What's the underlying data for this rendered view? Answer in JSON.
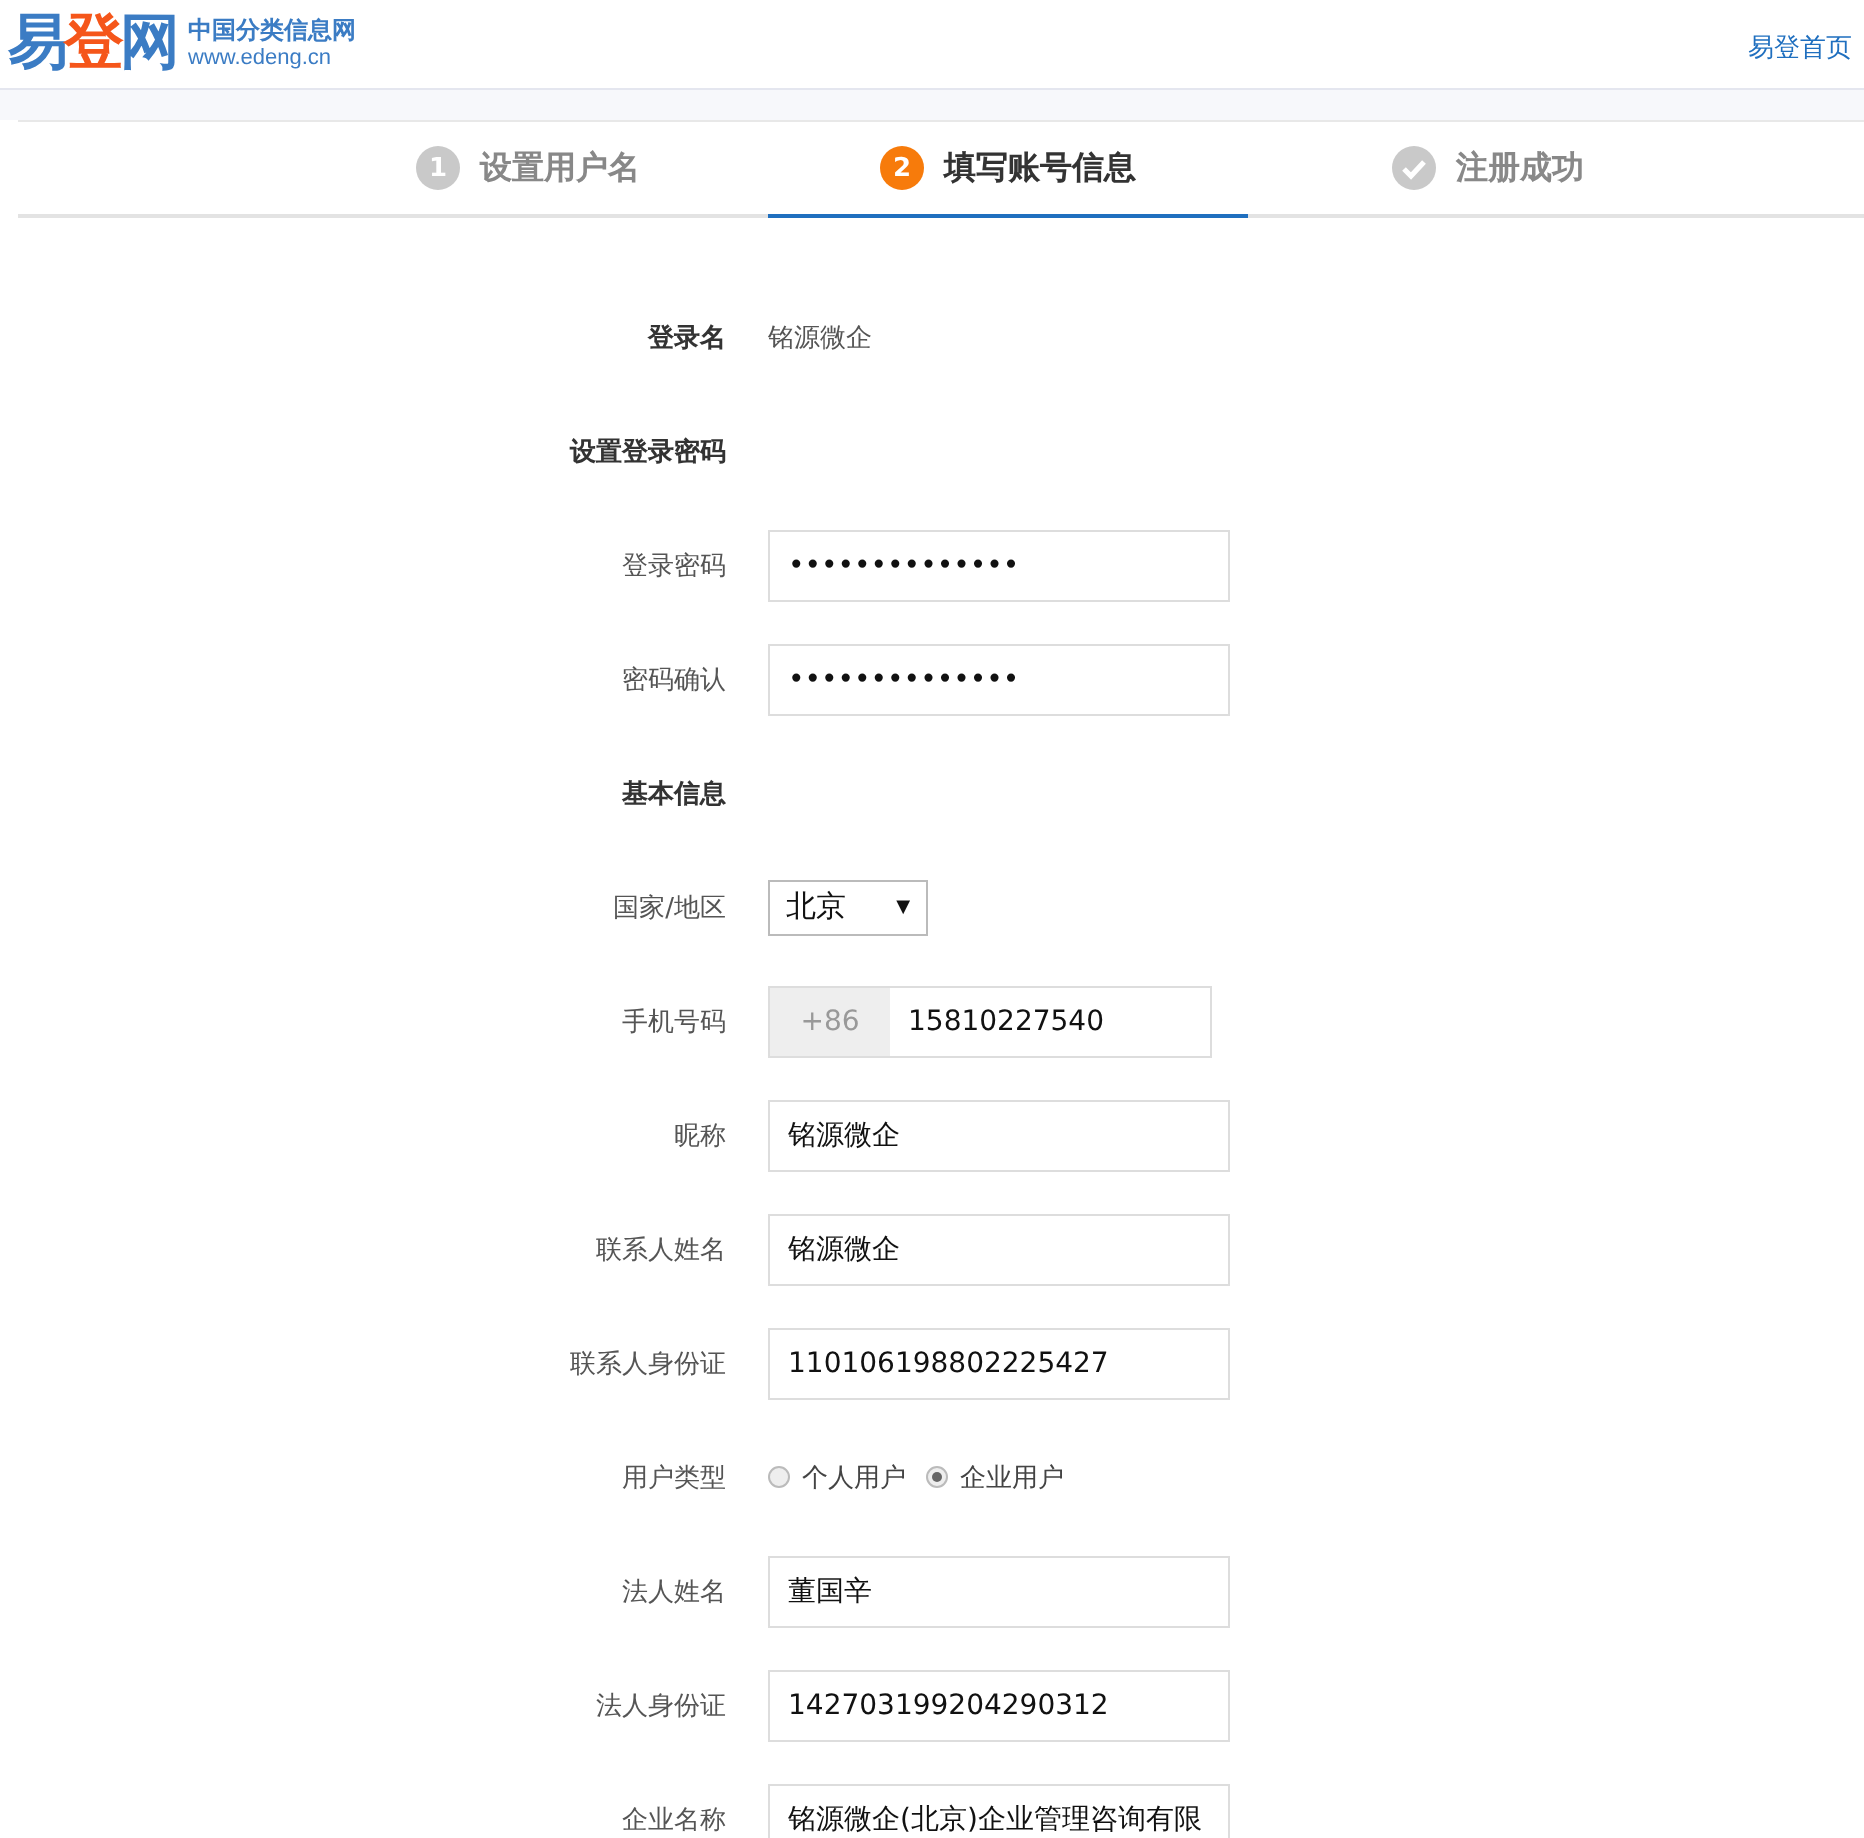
{
  "logo": {
    "parts": [
      {
        "text": "易",
        "color": "#3b7cc4"
      },
      {
        "text": "登",
        "color": "#f5561a"
      },
      {
        "text": "网",
        "color": "#3b7cc4"
      }
    ],
    "tagline": "中国分类信息网",
    "url": "www.edeng.cn"
  },
  "home_link": "易登首页",
  "steps": [
    {
      "kind": "number",
      "number": "1",
      "label": "设置用户名",
      "selected": false
    },
    {
      "kind": "number",
      "number": "2",
      "label": "填写账号信息",
      "selected": true
    },
    {
      "kind": "check",
      "label": "注册成功",
      "selected": false
    }
  ],
  "form": [
    {
      "kind": "static",
      "label": "登录名",
      "value": "铭源微企"
    },
    {
      "kind": "section",
      "label": "设置登录密码"
    },
    {
      "kind": "input",
      "label": "登录密码",
      "value": "••••••••••••••"
    },
    {
      "kind": "input",
      "label": "密码确认",
      "value": "••••••••••••••"
    },
    {
      "kind": "section",
      "label": "基本信息"
    },
    {
      "kind": "select",
      "label": "国家/地区",
      "value": "北京",
      "caret": "▼"
    },
    {
      "kind": "phone",
      "label": "手机号码",
      "prefix": "+86",
      "value": "15810227540"
    },
    {
      "kind": "input",
      "label": "昵称",
      "value": "铭源微企"
    },
    {
      "kind": "input",
      "label": "联系人姓名",
      "value": "铭源微企"
    },
    {
      "kind": "input",
      "label": "联系人身份证",
      "value": "110106198802225427"
    },
    {
      "kind": "radio",
      "label": "用户类型",
      "options": [
        {
          "label": "个人用户",
          "selected": false
        },
        {
          "label": "企业用户",
          "selected": true
        }
      ]
    },
    {
      "kind": "input",
      "label": "法人姓名",
      "value": "董国辛"
    },
    {
      "kind": "input",
      "label": "法人身份证",
      "value": "142703199204290312"
    },
    {
      "kind": "input",
      "label": "企业名称",
      "value": "铭源微企(北京)企业管理咨询有限"
    }
  ]
}
